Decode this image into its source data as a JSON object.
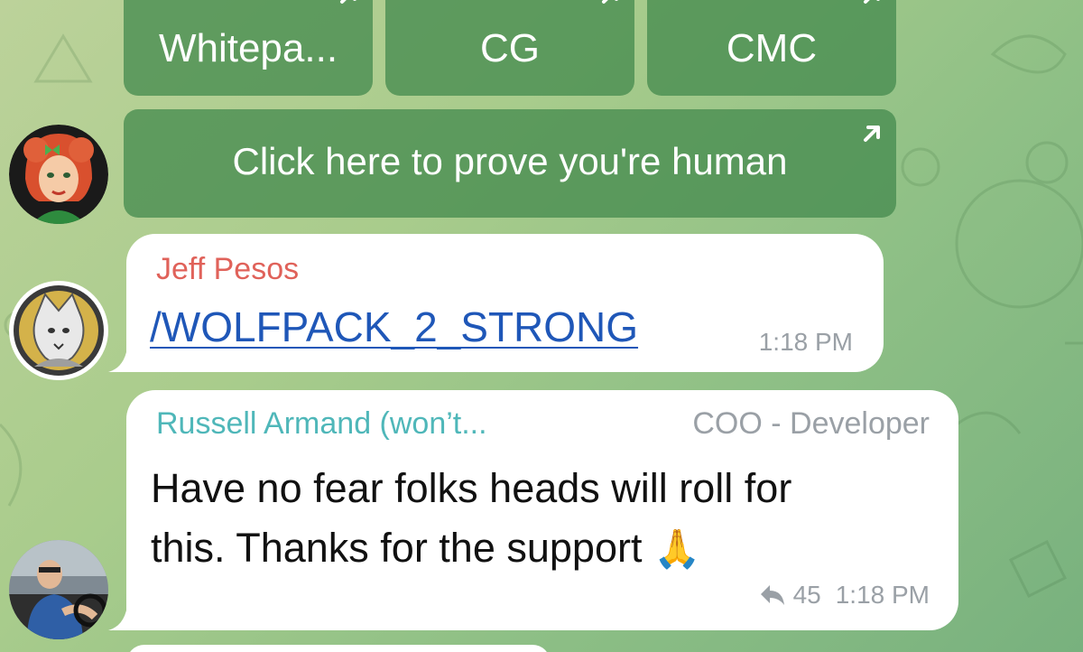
{
  "keyboard": {
    "buttons": [
      {
        "label": "Whitepa..."
      },
      {
        "label": "CG"
      },
      {
        "label": "CMC"
      },
      {
        "label": "Click here to prove you're human"
      }
    ]
  },
  "messages": [
    {
      "sender": "Jeff Pesos",
      "sender_color": "#e0625a",
      "text": "/WOLFPACK_2_STRONG",
      "text_color": "#1f57b8",
      "time": "1:18 PM"
    },
    {
      "sender": "Russell Armand (won’t...",
      "sender_color": "#4fb7b9",
      "role": "COO - Developer",
      "text_line1": "Have no fear folks heads will roll for",
      "text_line2": "this. Thanks for the support",
      "emoji": "🙏",
      "forward_count": "45",
      "time": "1:18 PM"
    }
  ],
  "icons": [
    "open-link-icon",
    "forward-icon",
    "folded-hands-emoji"
  ]
}
